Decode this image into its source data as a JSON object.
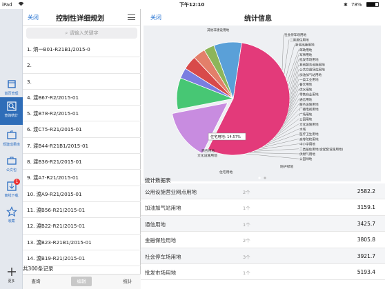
{
  "status": {
    "device": "iPad",
    "time": "下午12:10",
    "battery": "78%",
    "battery_level": 0.78
  },
  "sidebar": {
    "items": [
      {
        "label": "首页管理",
        "icon": "home-icon"
      },
      {
        "label": "查询统计",
        "icon": "query-stats-icon",
        "active": true
      },
      {
        "label": "规建成果库",
        "icon": "folder-icon"
      },
      {
        "label": "公文包",
        "icon": "briefcase-icon"
      },
      {
        "label": "离线下载",
        "icon": "download-icon",
        "badge": "1"
      },
      {
        "label": "收藏",
        "icon": "star-icon"
      },
      {
        "label": "更多",
        "icon": "plus-icon"
      }
    ]
  },
  "left": {
    "close": "关闭",
    "title": "控制性详细规划",
    "search_placeholder": "请输入关键字",
    "items": [
      "1. 炳一B01-R21B1/2015-0",
      "2.",
      "3.",
      "4. 渡B67-R2/2015-01",
      "5. 渡B78-R2/2015-01",
      "6. 渡C75-R21/2015-01",
      "7. 渡B44-R21B1/2015-01",
      "8. 渡B36-R21/2015-01",
      "9. 渡A7-R21/2015-01",
      "10. 渡A9-R21/2015-01",
      "11. 渡B56-R21/2015-01",
      "12. 渡B22-R21/2015-01",
      "13. 渡B23-R21B1/2015-01",
      "14. 渡B19-R21/2015-01"
    ],
    "count": "共300条记录",
    "btn_query": "查询",
    "btn_edit": "编辑",
    "btn_stats": "统计"
  },
  "right": {
    "close": "关闭",
    "title": "统计信息",
    "stats_title": "统计数据表",
    "rows": [
      {
        "name": "公用设施营业网点用地",
        "count": "2个",
        "value": "2582.2"
      },
      {
        "name": "加油加气站用地",
        "count": "1个",
        "value": "3159.1"
      },
      {
        "name": "通信用地",
        "count": "1个",
        "value": "3425.7"
      },
      {
        "name": "金融保险用地",
        "count": "2个",
        "value": "3805.8"
      },
      {
        "name": "社会停车场用地",
        "count": "3个",
        "value": "3921.7"
      },
      {
        "name": "批发市场用地",
        "count": "1个",
        "value": "5193.4"
      }
    ]
  },
  "chart_data": {
    "type": "pie",
    "tooltip": "住宅用地: 14.57%",
    "labels_top": [
      "其他非建设用地",
      "社会停车场用地",
      "二类居住用地",
      "新闻出版用地",
      "邮政用地",
      "军事用地",
      "批发市场用地",
      "其他服务设施用地",
      "公共交通场站用地",
      "加油加气站用地",
      "一类工业用地",
      "餐饮用地",
      "供水用地",
      "零售商业用地",
      "通信用地",
      "服务设施用地",
      "广播电视用地",
      "广场用地",
      "公园用地",
      "文化设施用地",
      "水域",
      "医疗卫生用地",
      "高等院校用地",
      "中小学用地",
      "二类居住用地(含配套设施用地)",
      "供燃气用地",
      "公园绿地"
    ],
    "labels_bottom": [
      "商务用地",
      "文化设施用地",
      "住宅用地",
      "防护绿地"
    ],
    "slices": [
      {
        "name": "其他非建设用地",
        "value": 55,
        "color": "#e33a7a"
      },
      {
        "name": "住宅用地",
        "value": 14.57,
        "color": "#c88ce0"
      },
      {
        "name": "防护绿地",
        "value": 9,
        "color": "#47c774"
      },
      {
        "name": "商务用地",
        "value": 3,
        "color": "#7a7ee0"
      },
      {
        "name": "公园绿地",
        "value": 4,
        "color": "#d84a4a"
      },
      {
        "name": "二类居住用地",
        "value": 3.5,
        "color": "#e37f6a"
      },
      {
        "name": "医疗卫生用地",
        "value": 3,
        "color": "#8db55a"
      },
      {
        "name": "其他",
        "value": 7.93,
        "color": "#5aa0d8"
      }
    ]
  }
}
